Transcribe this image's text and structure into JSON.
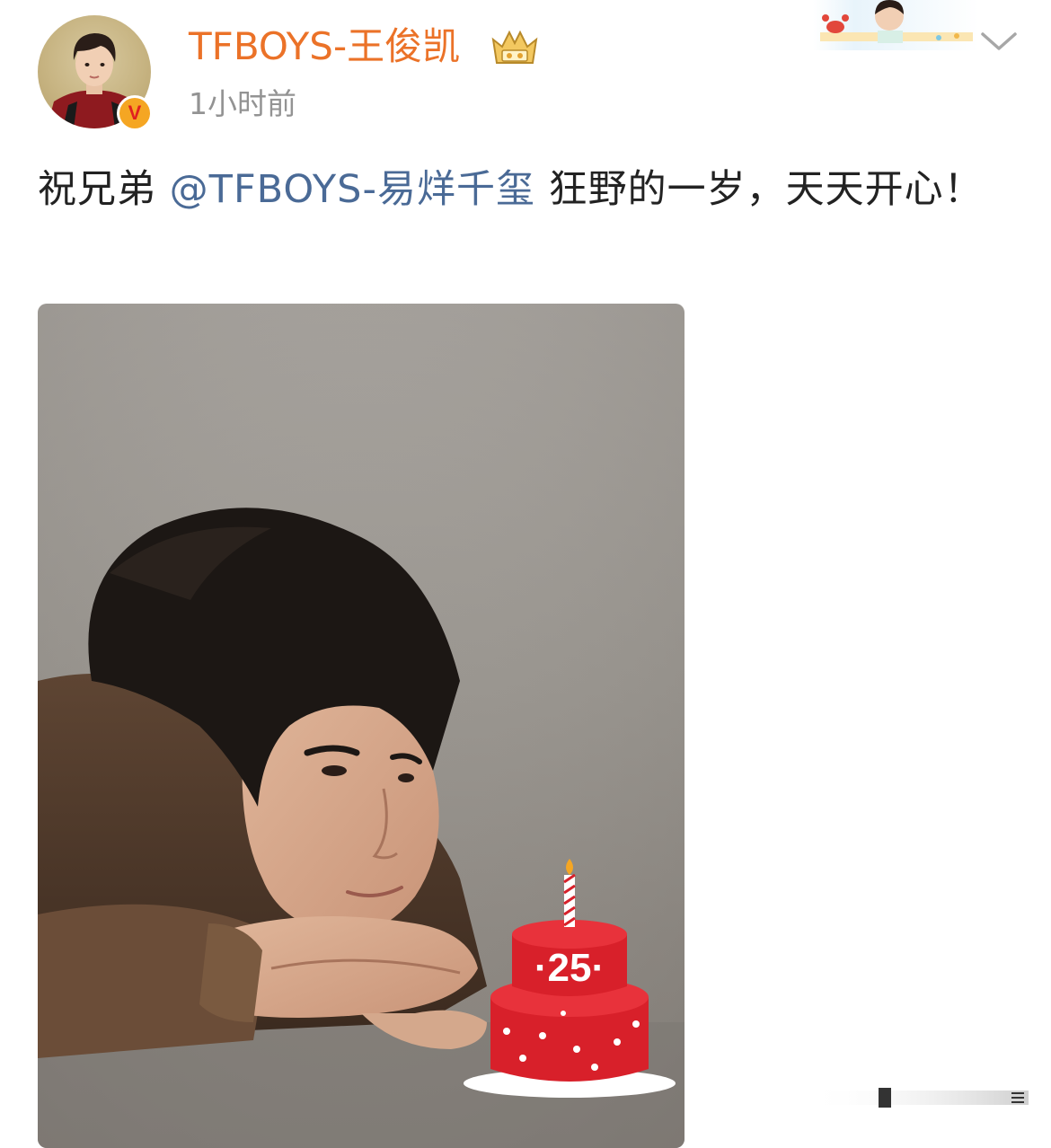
{
  "post": {
    "author": {
      "name": "TFBOYS-王俊凯",
      "verified_badge": "V",
      "time": "1小时前"
    },
    "text": {
      "prefix": "祝兄弟 ",
      "mention": "@TFBOYS-易烊千玺",
      "suffix": " 狂野的一岁，天天开心！"
    },
    "image": {
      "cake_number": "·25·"
    }
  },
  "colors": {
    "username": "#eb7228",
    "mention": "#4a6a96",
    "cake_red": "#d8202a"
  },
  "icons": [
    "avatar",
    "verified-badge-icon",
    "crown-badge-icon",
    "decorative-banner",
    "chevron-down-icon",
    "birthday-cake-sticker"
  ]
}
